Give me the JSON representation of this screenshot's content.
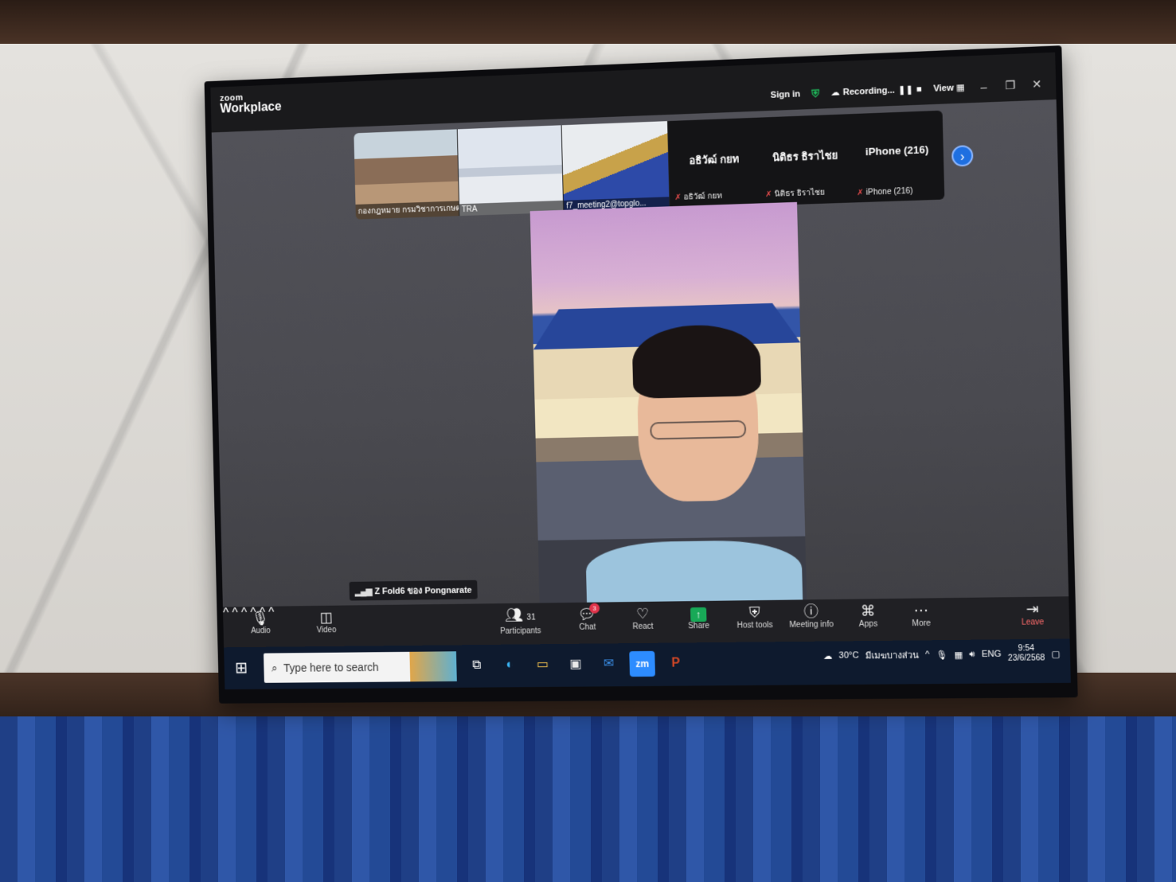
{
  "app": {
    "logo_top": "zoom",
    "logo_bottom": "Workplace"
  },
  "titlebar": {
    "sign_in": "Sign in",
    "recording": "Recording...",
    "view": "View",
    "minimize": "–",
    "restore": "❐",
    "close": "✕"
  },
  "gallery": {
    "thumbnails": [
      {
        "label": "กองกฎหมาย กรมวิชาการเกษตร"
      },
      {
        "label": "TRA"
      },
      {
        "label": "f7_meeting2@topglo..."
      }
    ],
    "participants": [
      {
        "display_name": "อธิวัฒ์ กยท",
        "caption": "อธิวัฒ์ กยท"
      },
      {
        "display_name": "นิติธร ธิราไชย",
        "caption": "นิติธร ธิราไชย"
      },
      {
        "display_name": "iPhone (216)",
        "caption": "iPhone (216)"
      }
    ],
    "next_icon": "›"
  },
  "active_speaker": {
    "connection_label": "Z Fold6 ของ Pongnarate"
  },
  "controls": {
    "audio": "Audio",
    "video": "Video",
    "participants_label": "Participants",
    "participants_count": "31",
    "chat": "Chat",
    "chat_badge": "3",
    "react": "React",
    "share": "Share",
    "host_tools": "Host tools",
    "meeting_info": "Meeting info",
    "apps": "Apps",
    "more": "More",
    "leave": "Leave"
  },
  "taskbar": {
    "search_placeholder": "Type here to search",
    "weather": "30°C",
    "weather_desc": "มีเมฆบางส่วน",
    "language": "ENG",
    "time": "9:54",
    "date": "23/6/2568"
  },
  "colors": {
    "share_green": "#18a957",
    "leave_red": "#ff6b6b",
    "accent_blue": "#1e6fe0",
    "security_green": "#1fb85a"
  }
}
